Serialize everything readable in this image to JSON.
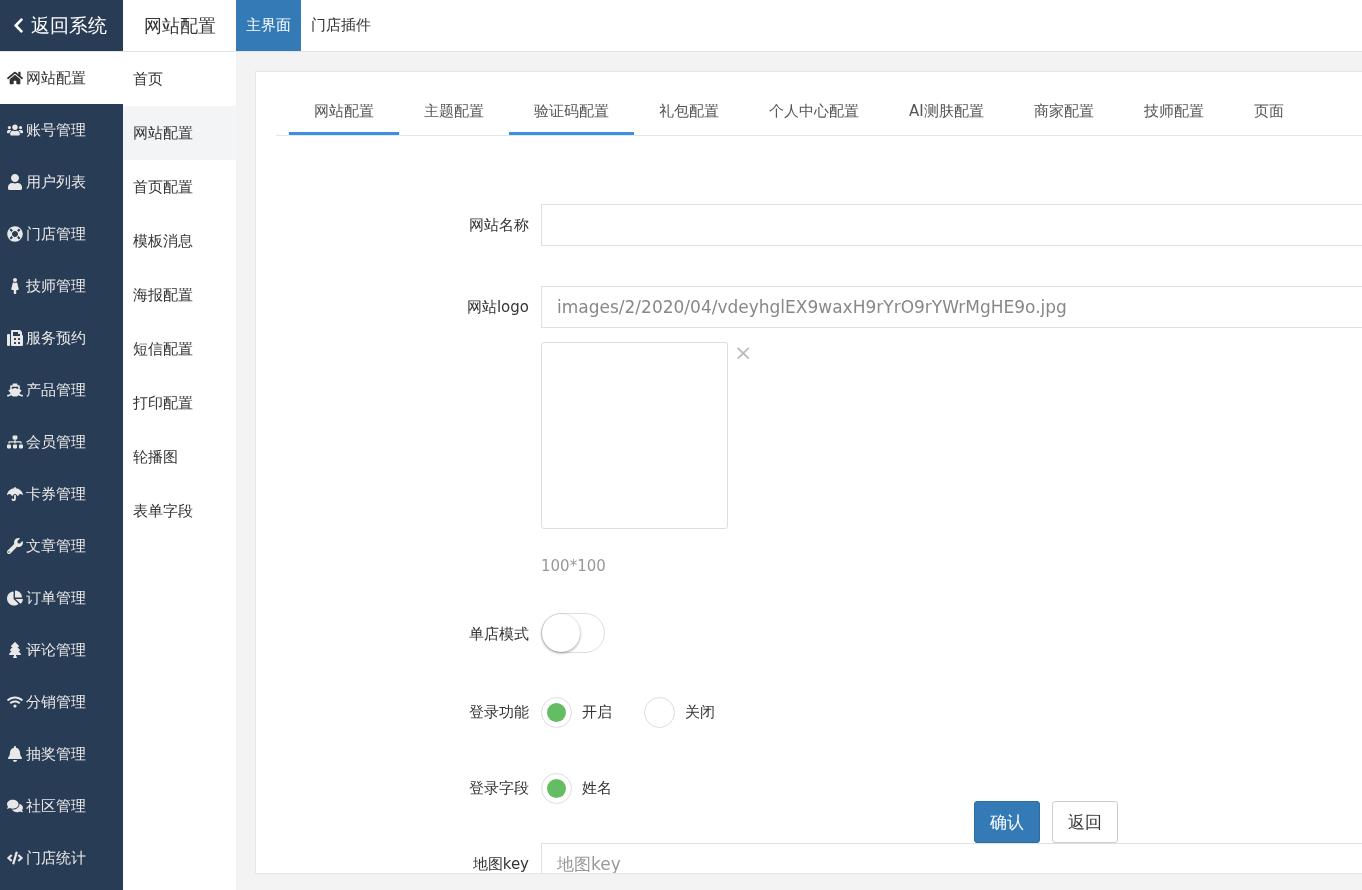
{
  "topbar": {
    "back": "返回系统",
    "section_title": "网站配置",
    "tabs": [
      {
        "label": "主界面",
        "selected": true
      },
      {
        "label": "门店插件",
        "selected": false
      }
    ]
  },
  "sidebar": {
    "items": [
      {
        "label": "网站配置",
        "selected": true
      },
      {
        "label": "账号管理",
        "selected": false
      },
      {
        "label": "用户列表",
        "selected": false
      },
      {
        "label": "门店管理",
        "selected": false
      },
      {
        "label": "技师管理",
        "selected": false
      },
      {
        "label": "服务预约",
        "selected": false
      },
      {
        "label": "产品管理",
        "selected": false
      },
      {
        "label": "会员管理",
        "selected": false
      },
      {
        "label": "卡券管理",
        "selected": false
      },
      {
        "label": "文章管理",
        "selected": false
      },
      {
        "label": "订单管理",
        "selected": false
      },
      {
        "label": "评论管理",
        "selected": false
      },
      {
        "label": "分销管理",
        "selected": false
      },
      {
        "label": "抽奖管理",
        "selected": false
      },
      {
        "label": "社区管理",
        "selected": false
      },
      {
        "label": "门店统计",
        "selected": false
      }
    ]
  },
  "submenu": {
    "items": [
      {
        "label": "首页",
        "selected": false
      },
      {
        "label": "网站配置",
        "selected": true
      },
      {
        "label": "首页配置",
        "selected": false
      },
      {
        "label": "模板消息",
        "selected": false
      },
      {
        "label": "海报配置",
        "selected": false
      },
      {
        "label": "短信配置",
        "selected": false
      },
      {
        "label": "打印配置",
        "selected": false
      },
      {
        "label": "轮播图",
        "selected": false
      },
      {
        "label": "表单字段",
        "selected": false
      }
    ]
  },
  "config_tabs": [
    {
      "label": "网站配置",
      "selected": true
    },
    {
      "label": "主题配置",
      "selected": false
    },
    {
      "label": "验证码配置",
      "selected": true
    },
    {
      "label": "礼包配置",
      "selected": false
    },
    {
      "label": "个人中心配置",
      "selected": false
    },
    {
      "label": "AI测肤配置",
      "selected": false
    },
    {
      "label": "商家配置",
      "selected": false
    },
    {
      "label": "技师配置",
      "selected": false
    },
    {
      "label": "页面",
      "selected": false
    }
  ],
  "form": [
    {
      "kind": "text",
      "label": "网站名称"
    },
    {
      "kind": "image",
      "label": "网站logo",
      "value": "images/2/2020/04/vdeyhglEX9waxH9rYrO9rYWrMgHE9o.jpg",
      "close": "×",
      "hint": "100*100"
    },
    {
      "kind": "switch",
      "label": "单店模式",
      "on": false
    },
    {
      "kind": "radio",
      "label": "登录功能",
      "options": [
        {
          "label": "开启",
          "selected": true
        },
        {
          "label": "关闭",
          "selected": false
        }
      ]
    },
    {
      "kind": "radio",
      "label": "登录字段",
      "options": [
        {
          "label": "姓名",
          "selected": true
        }
      ]
    },
    {
      "kind": "text",
      "label": "地图key",
      "placeholder": "地图key"
    }
  ],
  "actions": [
    {
      "label": "确认",
      "kind": "primary"
    },
    {
      "label": "返回",
      "kind": "default"
    }
  ]
}
